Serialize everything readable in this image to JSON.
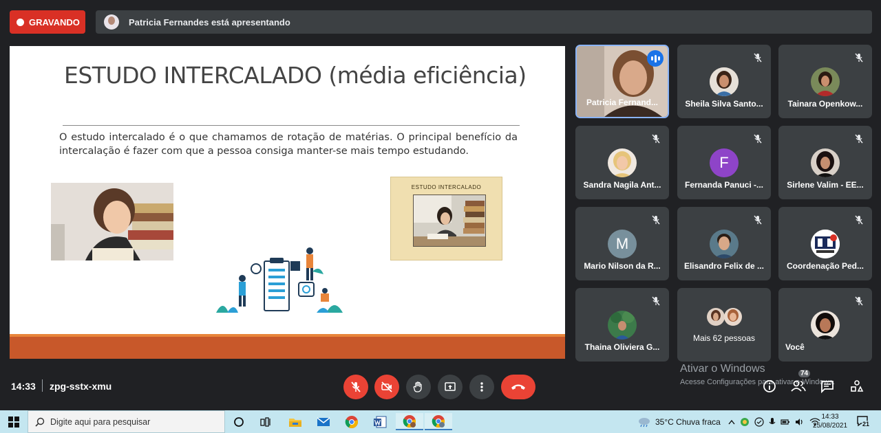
{
  "recording": {
    "label": "GRAVANDO"
  },
  "presenting": {
    "text": "Patricia Fernandes está apresentando"
  },
  "slide": {
    "title": "ESTUDO INTERCALADO (média eficiência)",
    "body": "O estudo intercalado é o que chamamos de rotação de matérias. O principal benefício da intercalação é fazer com que a pessoa consiga manter-se mais tempo estudando.",
    "image_label": "ESTUDO   INTERCALADO"
  },
  "participants": [
    {
      "name": "Patricia Fernand...",
      "speaking": true
    },
    {
      "name": "Sheila Silva Santo...",
      "muted": true
    },
    {
      "name": "Tainara Openkow...",
      "muted": true
    },
    {
      "name": "Sandra Nagila Ant...",
      "muted": true
    },
    {
      "name": "Fernanda Panuci -...",
      "muted": true,
      "initial": "F",
      "color": "#8e44c8"
    },
    {
      "name": "Sirlene Valim - EE...",
      "muted": true
    },
    {
      "name": "Mario Nilson da R...",
      "muted": true,
      "initial": "M",
      "color": "#78909c"
    },
    {
      "name": "Elisandro Felix de ...",
      "muted": true
    },
    {
      "name": "Coordenação Ped...",
      "muted": true
    },
    {
      "name": "Thaina Oliviera G...",
      "muted": true
    },
    {
      "name": "Mais 62 pessoas"
    },
    {
      "name": "Você",
      "muted": true
    }
  ],
  "watermark": {
    "title": "Ativar o Windows",
    "subtitle": "Acesse Configurações para ativar o Windows."
  },
  "meeting": {
    "time": "14:33",
    "code": "zpg-sstx-xmu",
    "participant_count": "74"
  },
  "taskbar": {
    "search_placeholder": "Digite aqui para pesquisar",
    "weather": "35°C  Chuva fraca",
    "time": "14:33",
    "date": "25/08/2021",
    "notifications": "21"
  },
  "colors": {
    "record_red": "#d93025",
    "control_red": "#ea4335",
    "active_border": "#8ab4f8",
    "slide_footer": "#c8582a"
  }
}
